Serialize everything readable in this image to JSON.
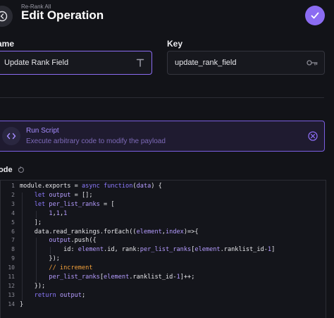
{
  "header": {
    "breadcrumb": "Re-Rank All",
    "title": "Edit Operation"
  },
  "fields": {
    "name_label": "ame",
    "name_value": "Update Rank Field",
    "key_label": "Key",
    "key_value": "update_rank_field"
  },
  "script_card": {
    "title": "Run Script",
    "description": "Execute arbitrary code to modify the payload"
  },
  "code": {
    "label": "ode",
    "line_numbers": [
      "1",
      "2",
      "3",
      "4",
      "5",
      "6",
      "7",
      "8",
      "9",
      "10",
      "11",
      "12",
      "13",
      "14"
    ],
    "lines": [
      [
        {
          "t": "plain",
          "v": "module.exports = "
        },
        {
          "t": "kw",
          "v": "async function"
        },
        {
          "t": "plain",
          "v": "("
        },
        {
          "t": "prop",
          "v": "data"
        },
        {
          "t": "plain",
          "v": ") {"
        }
      ],
      [
        {
          "t": "plain",
          "v": "    "
        },
        {
          "t": "kw",
          "v": "let"
        },
        {
          "t": "plain",
          "v": " "
        },
        {
          "t": "prop",
          "v": "output"
        },
        {
          "t": "plain",
          "v": " = [];"
        }
      ],
      [
        {
          "t": "plain",
          "v": "    "
        },
        {
          "t": "kw",
          "v": "let"
        },
        {
          "t": "plain",
          "v": " "
        },
        {
          "t": "prop",
          "v": "per_list_ranks"
        },
        {
          "t": "plain",
          "v": " = ["
        }
      ],
      [
        {
          "t": "plain",
          "v": "        "
        },
        {
          "t": "num",
          "v": "1"
        },
        {
          "t": "plain",
          "v": ","
        },
        {
          "t": "num",
          "v": "1"
        },
        {
          "t": "plain",
          "v": ","
        },
        {
          "t": "num",
          "v": "1"
        }
      ],
      [
        {
          "t": "plain",
          "v": "    ];"
        }
      ],
      [
        {
          "t": "plain",
          "v": "    data.read_rankings.forEach(("
        },
        {
          "t": "prop",
          "v": "element"
        },
        {
          "t": "plain",
          "v": ","
        },
        {
          "t": "prop",
          "v": "index"
        },
        {
          "t": "plain",
          "v": ")=>{"
        }
      ],
      [
        {
          "t": "plain",
          "v": "        "
        },
        {
          "t": "prop",
          "v": "output"
        },
        {
          "t": "plain",
          "v": ".push({"
        }
      ],
      [
        {
          "t": "plain",
          "v": "            id: "
        },
        {
          "t": "prop",
          "v": "element"
        },
        {
          "t": "plain",
          "v": ".id, rank:"
        },
        {
          "t": "prop",
          "v": "per_list_ranks"
        },
        {
          "t": "plain",
          "v": "["
        },
        {
          "t": "prop",
          "v": "element"
        },
        {
          "t": "plain",
          "v": ".ranklist_id-"
        },
        {
          "t": "num",
          "v": "1"
        },
        {
          "t": "plain",
          "v": "]"
        }
      ],
      [
        {
          "t": "plain",
          "v": "        });"
        }
      ],
      [
        {
          "t": "plain",
          "v": "        "
        },
        {
          "t": "cm",
          "v": "// increment"
        }
      ],
      [
        {
          "t": "plain",
          "v": "        "
        },
        {
          "t": "prop",
          "v": "per_list_ranks"
        },
        {
          "t": "plain",
          "v": "["
        },
        {
          "t": "prop",
          "v": "element"
        },
        {
          "t": "plain",
          "v": ".ranklist_id-"
        },
        {
          "t": "num",
          "v": "1"
        },
        {
          "t": "plain",
          "v": "]++;"
        }
      ],
      [
        {
          "t": "plain",
          "v": "    });"
        }
      ],
      [
        {
          "t": "plain",
          "v": "    "
        },
        {
          "t": "kw",
          "v": "return"
        },
        {
          "t": "plain",
          "v": " "
        },
        {
          "t": "prop",
          "v": "output"
        },
        {
          "t": "plain",
          "v": ";"
        }
      ],
      [
        {
          "t": "plain",
          "v": "}"
        }
      ]
    ]
  },
  "colors": {
    "accent": "#8b6cf2",
    "background": "#121318",
    "comment": "#f2a03a"
  }
}
